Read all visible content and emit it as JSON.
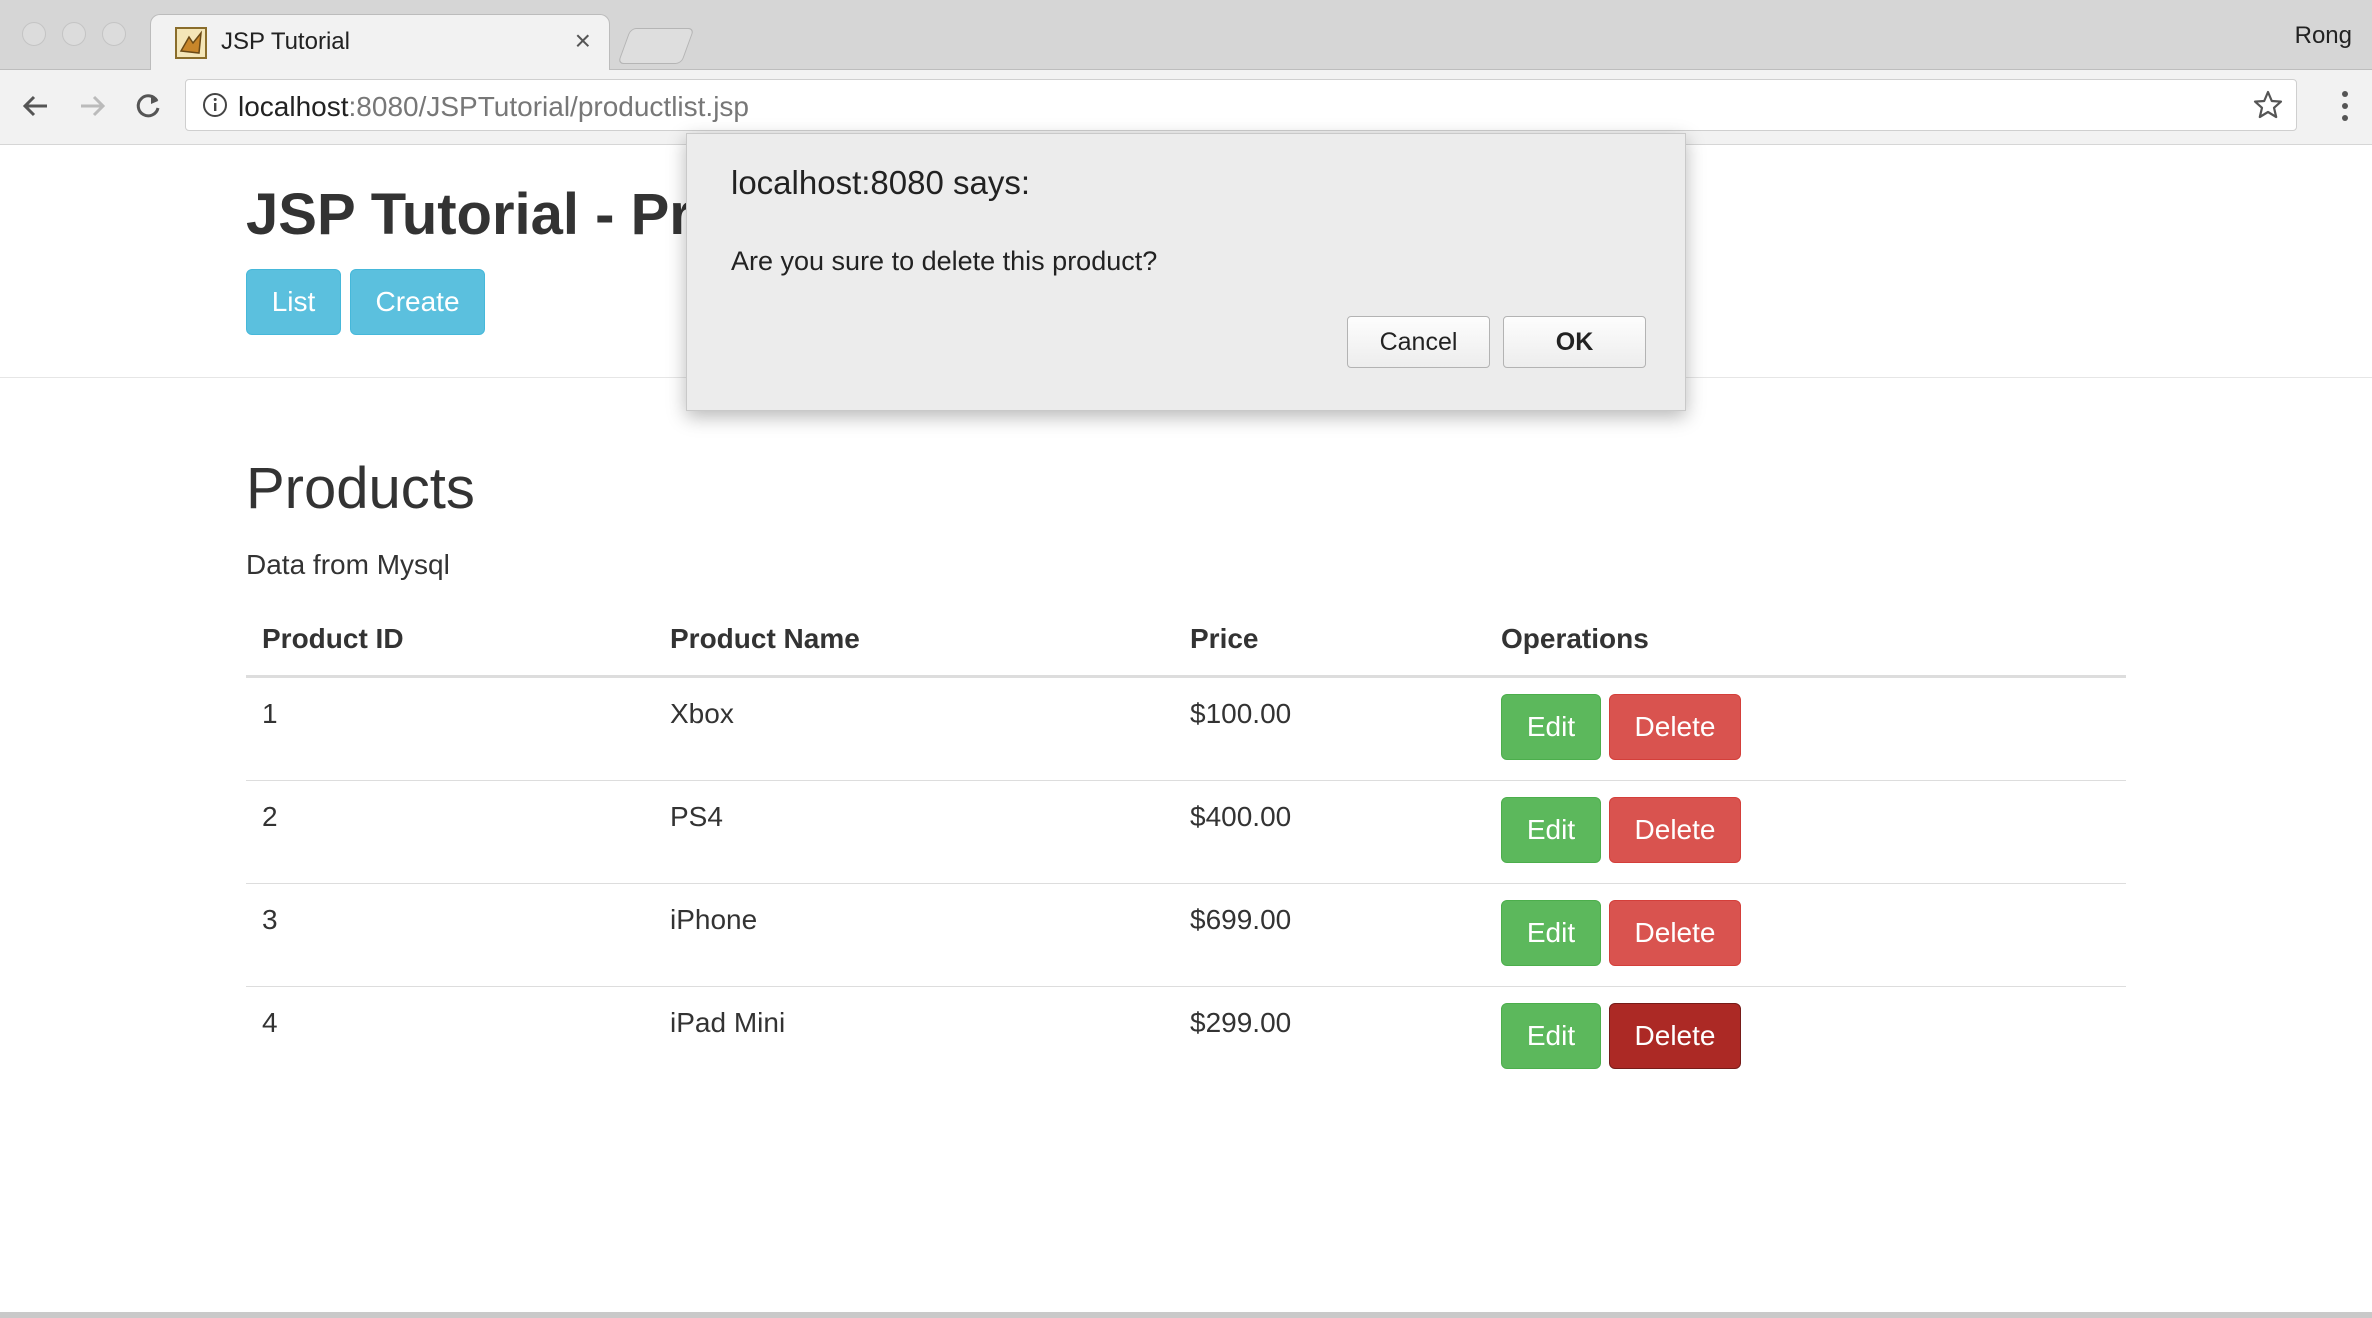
{
  "browser": {
    "tab_title": "JSP Tutorial",
    "profile_name": "Rong",
    "url_host": "localhost",
    "url_rest": ":8080/JSPTutorial/productlist.jsp",
    "icons": [
      "back-icon",
      "forward-icon",
      "reload-icon",
      "info-icon",
      "bookmark-star-icon",
      "menu-icon",
      "favicon-icon",
      "close-icon"
    ]
  },
  "header": {
    "title": "JSP Tutorial - Pr",
    "list_label": "List",
    "create_label": "Create"
  },
  "main": {
    "title": "Products",
    "subtitle": "Data from Mysql",
    "columns": [
      "Product ID",
      "Product Name",
      "Price",
      "Operations"
    ],
    "rows": [
      {
        "id": "1",
        "name": "Xbox",
        "price": "$100.00",
        "edit": "Edit",
        "delete": "Delete"
      },
      {
        "id": "2",
        "name": "PS4",
        "price": "$400.00",
        "edit": "Edit",
        "delete": "Delete"
      },
      {
        "id": "3",
        "name": "iPhone",
        "price": "$699.00",
        "edit": "Edit",
        "delete": "Delete"
      },
      {
        "id": "4",
        "name": "iPad Mini",
        "price": "$299.00",
        "edit": "Edit",
        "delete": "Delete"
      }
    ]
  },
  "dialog": {
    "title": "localhost:8080 says:",
    "message": "Are you sure to delete this product?",
    "cancel_label": "Cancel",
    "ok_label": "OK"
  },
  "colors": {
    "info": "#5bc0de",
    "success": "#5cb85c",
    "danger": "#d9534f",
    "danger_active": "#ac2925"
  }
}
